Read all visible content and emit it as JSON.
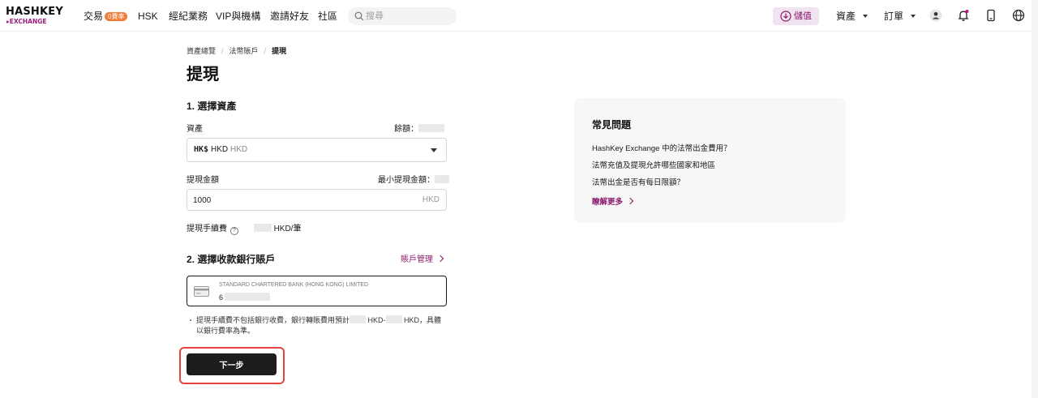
{
  "brand": {
    "logo_top": "HASHKEY",
    "logo_bottom": "EXCHANGE"
  },
  "nav": {
    "items": [
      {
        "label": "交易",
        "badge": "0費率"
      },
      {
        "label": "HSK"
      },
      {
        "label": "經紀業務"
      },
      {
        "label": "VIP與機構"
      },
      {
        "label": "邀請好友"
      },
      {
        "label": "社區"
      }
    ],
    "search_placeholder": "搜尋",
    "deposit_label": "儲值",
    "assets_label": "資產",
    "orders_label": "訂單"
  },
  "breadcrumb": {
    "items": [
      "資產總覽",
      "法幣賬戶",
      "提現"
    ]
  },
  "page_title": "提現",
  "step1": {
    "title": "1. 選擇資產",
    "asset_label": "資產",
    "balance_label": "餘額：",
    "asset_symbol": "HK$",
    "asset_code": "HKD",
    "asset_name": "HKD",
    "amount_label": "提現金額",
    "min_label": "最小提現金額：",
    "amount_value": "1000",
    "amount_unit": "HKD",
    "fee_label": "提現手續費",
    "fee_unit": "HKD/筆"
  },
  "step2": {
    "title": "2. 選擇收款銀行賬戶",
    "manage_link": "賬戶管理",
    "bank_name": "STANDARD CHARTERED BANK (HONG KONG) LIMITED",
    "account_prefix": "6"
  },
  "note": {
    "part1": "提現手續費不包括銀行收費，銀行轉賬費用預計",
    "part2": "HKD-",
    "part3": "HKD，具體以銀行費率為準。"
  },
  "next_button": "下一步",
  "faq": {
    "title": "常見問題",
    "questions": [
      "HashKey Exchange 中的法幣出金費用？",
      "法幣充值及提現允許哪些國家和地區",
      "法幣出金是否有每日限額？"
    ],
    "more_link": "瞭解更多"
  },
  "colors": {
    "accent": "#8c1a6e",
    "badge": "#f07c3a",
    "highlight": "#e5453d",
    "button": "#1d1d20"
  }
}
